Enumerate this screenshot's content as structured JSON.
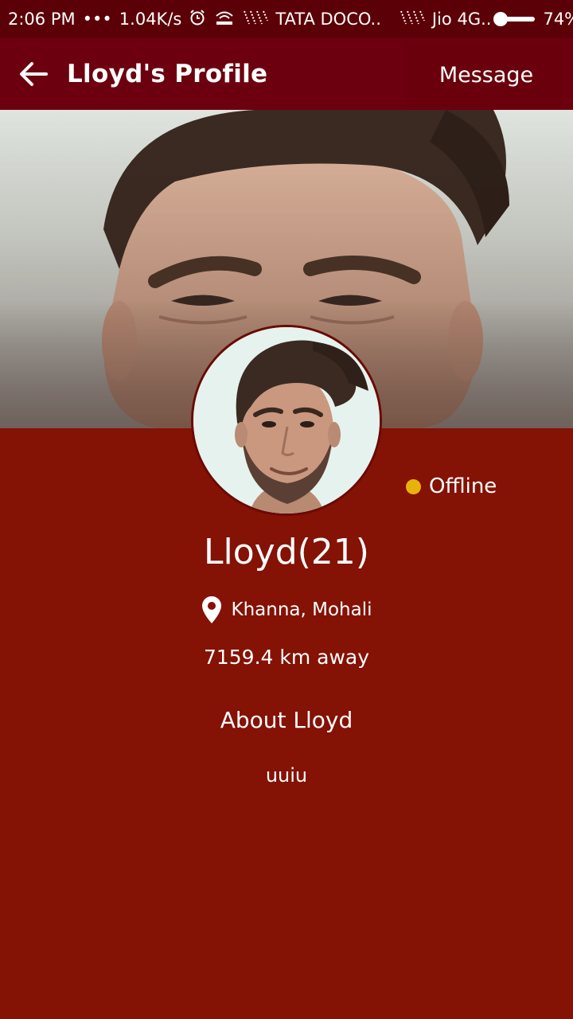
{
  "status_bar": {
    "time": "2:06 PM",
    "dots": "•••",
    "speed": "1.04K/s",
    "carrier1": "TATA DOCO..",
    "carrier2": "Jio 4G..",
    "battery": "74%"
  },
  "app_bar": {
    "title": "Lloyd's Profile",
    "message_label": "Message"
  },
  "profile": {
    "status": "Offline",
    "name": "Lloyd(21)",
    "location": "Khanna, Mohali",
    "distance": "7159.4 km away",
    "about_heading": "About Lloyd",
    "about_text": "uuiu"
  },
  "colors": {
    "status_bar": "#5c0007",
    "app_bar": "#6c000e",
    "background": "#841205",
    "status_dot": "#e7b30b"
  }
}
